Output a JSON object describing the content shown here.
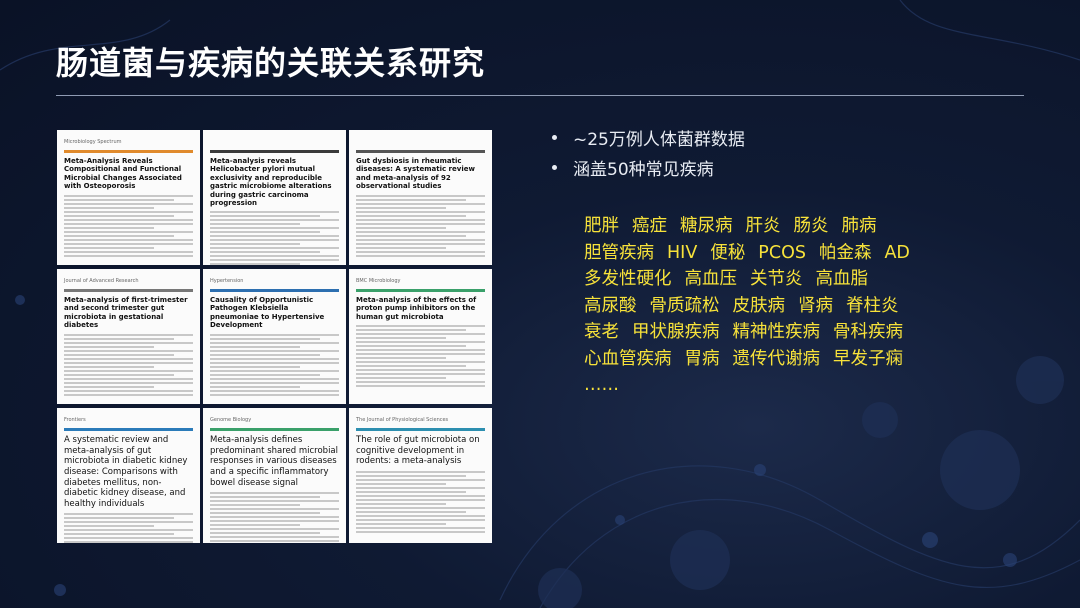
{
  "slide": {
    "title": "肠道菌与疾病的关联关系研究"
  },
  "bullets": [
    "~25万例人体菌群数据",
    "涵盖50种常见疾病"
  ],
  "diseases": [
    [
      "肥胖",
      "癌症",
      "糖尿病",
      "肝炎",
      "肠炎",
      "肺病"
    ],
    [
      "胆管疾病",
      "HIV",
      "便秘",
      "PCOS",
      "帕金森",
      "AD"
    ],
    [
      "多发性硬化",
      "高血压",
      "关节炎",
      "高血脂"
    ],
    [
      "高尿酸",
      "骨质疏松",
      "皮肤病",
      "肾病",
      "脊柱炎"
    ],
    [
      "衰老",
      "甲状腺疾病",
      "精神性疾病",
      "骨科疾病"
    ],
    [
      "心血管疾病",
      "胃病",
      "遗传代谢病",
      "早发子痫"
    ],
    [
      "……"
    ]
  ],
  "papers": [
    {
      "title": "Meta-Analysis Reveals Compositional and Functional Microbial Changes Associated with Osteoporosis",
      "journal": "Microbiology Spectrum",
      "accent": "#e08a2c"
    },
    {
      "title": "Meta-analysis reveals Helicobacter pylori mutual exclusivity and reproducible gastric microbiome alterations during gastric carcinoma progression",
      "journal": "",
      "accent": "#3a3a3a"
    },
    {
      "title": "Gut dysbiosis in rheumatic diseases: A systematic review and meta-analysis of 92 observational studies",
      "journal": "",
      "accent": "#555555"
    },
    {
      "title": "Meta-analysis of first-trimester and second trimester gut microbiota in gestational diabetes",
      "journal": "Journal of Advanced Research",
      "accent": "#777777"
    },
    {
      "title": "Causality of Opportunistic Pathogen Klebsiella pneumoniae to Hypertensive Development",
      "journal": "Hypertension",
      "accent": "#2d6fb0"
    },
    {
      "title": "Meta-analysis of the effects of proton pump inhibitors on the human gut microbiota",
      "journal": "BMC Microbiology",
      "accent": "#3aa06a"
    },
    {
      "title": "A systematic review and meta-analysis of gut microbiota in diabetic kidney disease: Comparisons with diabetes mellitus, non-diabetic kidney disease, and healthy individuals",
      "journal": "Frontiers",
      "accent": "#2b7bb9"
    },
    {
      "title": "Meta-analysis defines predominant shared microbial responses in various diseases and a specific inflammatory bowel disease signal",
      "journal": "Genome Biology",
      "accent": "#3aa06a"
    },
    {
      "title": "The role of gut microbiota on cognitive development in rodents: a meta-analysis",
      "journal": "The Journal of Physiological Sciences",
      "accent": "#2d8fb0"
    }
  ]
}
